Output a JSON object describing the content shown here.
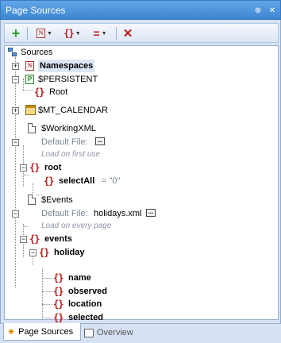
{
  "window": {
    "title": "Page Sources",
    "pin_glyph": "⊕",
    "close_glyph": "✕"
  },
  "toolbar": {
    "add_glyph": "+",
    "namespace_glyph": "N",
    "element_glyph": "{}",
    "equals_glyph": "=",
    "delete_glyph": "✕",
    "dropdown_glyph": "▼"
  },
  "tree": {
    "expander_plus": "+",
    "expander_minus": "−",
    "brace_glyph": "{}",
    "ns_glyph": "N",
    "p_glyph": "P",
    "browse_glyph": "...",
    "sources": "Sources",
    "namespaces": "Namespaces",
    "persistent": "$PERSISTENT",
    "root1": "Root",
    "mt_calendar": "$MT_CALENDAR",
    "working_xml": "$WorkingXML",
    "default_file_label1": "Default File:",
    "default_file_value1": "",
    "load_note1": "Load on first use",
    "root2": "root",
    "select_all": "selectAll",
    "select_all_value": "= \"0\"",
    "events_source": "$Events",
    "default_file_label2": "Default File:",
    "default_file_value2": "holidays.xml",
    "load_note2": "Load on every page",
    "events": "events",
    "holiday": "holiday",
    "children": [
      "name",
      "observed",
      "location",
      "selected"
    ]
  },
  "tabs": {
    "active": "Page Sources",
    "inactive": "Overview"
  },
  "colors": {
    "title_bar": "#4a93dd",
    "brace": "#c01818",
    "add": "#2e9e2e"
  }
}
